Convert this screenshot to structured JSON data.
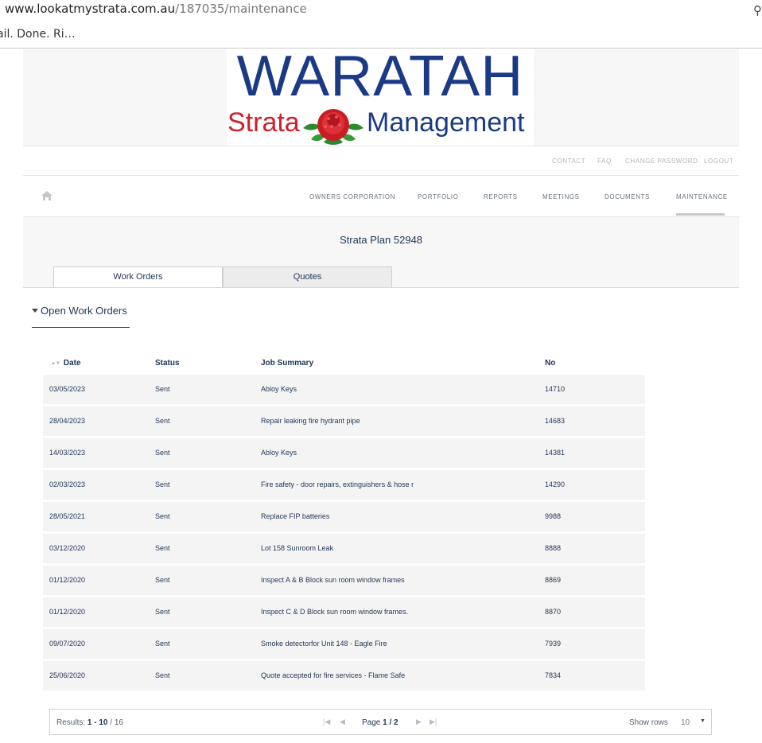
{
  "browser": {
    "url_host": "www.lookatmystrata.com.au",
    "url_path": "/187035/maintenance",
    "tab_title": "ail. Done. Ri…"
  },
  "logo": {
    "word": "WARATAH",
    "left_text": "Strata",
    "right_text": "Management"
  },
  "top_links": [
    "CONTACT",
    "FAQ",
    "CHANGE PASSWORD",
    "LOGOUT"
  ],
  "nav": {
    "items": [
      "OWNERS CORPORATION",
      "PORTFOLIO",
      "REPORTS",
      "MEETINGS",
      "DOCUMENTS",
      "MAINTENANCE"
    ],
    "active": "MAINTENANCE"
  },
  "plan_title": "Strata Plan 52948",
  "tabs": [
    "Work Orders",
    "Quotes"
  ],
  "section_title": "Open Work Orders",
  "table": {
    "headers": [
      "Date",
      "Status",
      "Job Summary",
      "No"
    ],
    "rows": [
      [
        "03/05/2023",
        "Sent",
        "Abloy Keys",
        "14710"
      ],
      [
        "28/04/2023",
        "Sent",
        "Repair leaking fire hydrant pipe",
        "14683"
      ],
      [
        "14/03/2023",
        "Sent",
        "Abloy Keys",
        "14381"
      ],
      [
        "02/03/2023",
        "Sent",
        "Fire safety - door repairs, extinguishers & hose r",
        "14290"
      ],
      [
        "28/05/2021",
        "Sent",
        "Replace FIP batteries",
        "9988"
      ],
      [
        "03/12/2020",
        "Sent",
        "Lot 158 Sunroom Leak",
        "8888"
      ],
      [
        "01/12/2020",
        "Sent",
        "Inspect A & B Block sun room window frames",
        "8869"
      ],
      [
        "01/12/2020",
        "Sent",
        "Inspect C & D Block sun room window frames.",
        "8870"
      ],
      [
        "09/07/2020",
        "Sent",
        "Smoke detectorfor Unit 148 - Eagle Fire",
        "7939"
      ],
      [
        "25/06/2020",
        "Sent",
        "Quote accepted for fire services - Flame Safe",
        "7834"
      ]
    ]
  },
  "pager": {
    "results_label": "Results:",
    "results_range": "1 - 10",
    "results_total": "/ 16",
    "page_label": "Page",
    "page_value": "1 / 2",
    "show_rows_label": "Show rows",
    "rows_value": "10"
  },
  "colors": {
    "brand_blue": "#1b3a86",
    "brand_red": "#d0202a",
    "text": "#1f3556"
  }
}
